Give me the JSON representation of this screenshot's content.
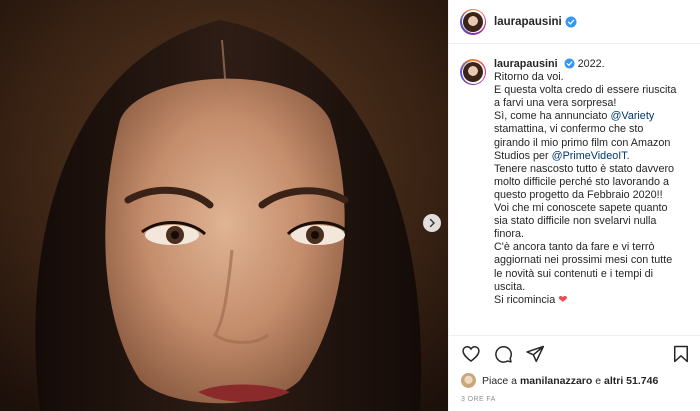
{
  "post": {
    "username": "laurapausini",
    "verified": true
  },
  "caption": {
    "lines": [
      "2022.",
      "Ritorno da voi.",
      "E questa volta credo di essere riuscita",
      "a farvi una vera sorpresa!",
      "Sì, come ha annunciato @Variety",
      "stamattina, vi confermo che sto",
      "girando il mio primo film con Amazon",
      "Studios per @PrimeVideoIT.",
      "Tenere nascosto tutto è stato davvero",
      "molto difficile perché sto lavorando a",
      "questo progetto da Febbraio 2020!!",
      "Voi che mi conoscete sapete quanto",
      "sia stato difficile non svelarvi nulla",
      "finora.",
      "C'è ancora tanto da fare e vi terrò",
      "aggiornati nei prossimi mesi con tutte",
      "le novità sui contenuti e i tempi di",
      "uscita.",
      "Si ricomincia"
    ],
    "mention_variety": "@Variety",
    "mention_prime": "@PrimeVideoIT",
    "heart": "❤"
  },
  "likes": {
    "prefix": "Piace a",
    "user": "manilanazzaro",
    "middle": "e",
    "others": "altri 51.746"
  },
  "timestamp": "3 ORE FA",
  "icons": {
    "like": "heart-outline-icon",
    "comment": "comment-icon",
    "share": "paper-plane-icon",
    "save": "bookmark-icon",
    "next": "chevron-right-icon",
    "verified": "verified-badge-icon"
  },
  "colors": {
    "verified": "#3897f0",
    "mention": "#00376b",
    "heart": "#ed4956",
    "muted": "#8e8e8e"
  }
}
